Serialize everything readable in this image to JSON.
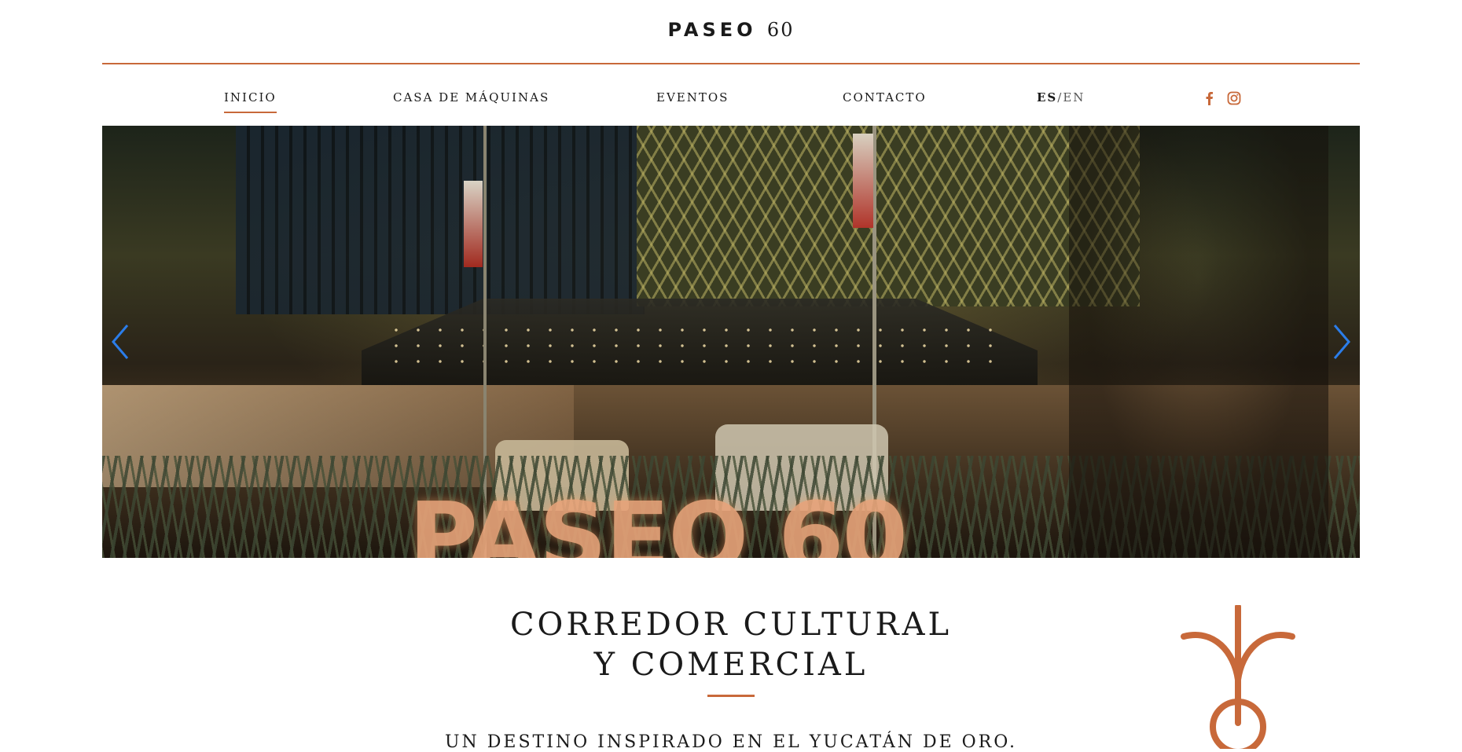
{
  "header": {
    "logo_text": "PASEO",
    "logo_number": "60"
  },
  "nav": {
    "items": [
      {
        "label": "INICIO",
        "active": true
      },
      {
        "label": "CASA DE MÁQUINAS"
      },
      {
        "label": "EVENTOS"
      },
      {
        "label": "CONTACTO"
      }
    ],
    "lang_active": "ES",
    "lang_sep": "/",
    "lang_other": "EN",
    "social_icons": [
      "facebook-icon",
      "instagram-icon"
    ]
  },
  "hero": {
    "image_text": "PASEO 60",
    "prev_icon": "chevron-left-icon",
    "next_icon": "chevron-right-icon"
  },
  "content": {
    "heading_line1": "CORREDOR CULTURAL",
    "heading_line2": "Y COMERCIAL",
    "subtitle": "UN DESTINO INSPIRADO EN EL YUCATÁN DE ORO."
  },
  "colors": {
    "accent": "#c8693a",
    "arrow": "#2b7de9",
    "text": "#1a1a1a"
  }
}
